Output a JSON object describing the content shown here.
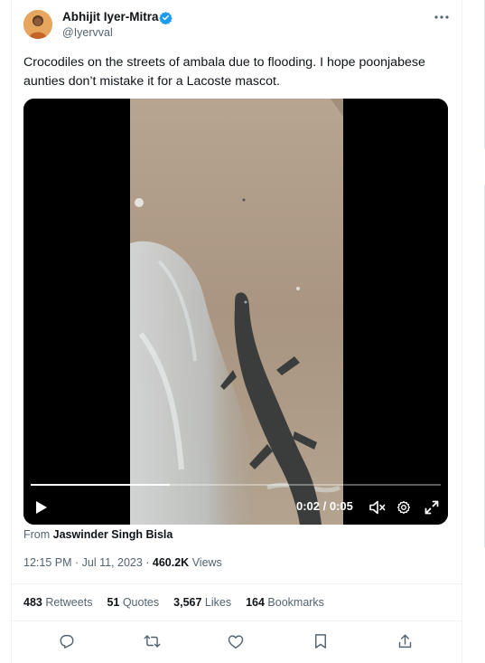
{
  "author": {
    "name": "Abhijit Iyer-Mitra",
    "handle": "@Iyervval"
  },
  "tweet": {
    "text": "Crocodiles on the streets of ambala due to flooding. I hope poonjabese aunties don’t mistake it for a Lacoste mascot."
  },
  "video": {
    "current_time": "0:02",
    "separator": " / ",
    "duration": "0:05",
    "progress": 0.34
  },
  "source": {
    "prefix": "From ",
    "name": "Jaswinder Singh Bisla"
  },
  "meta": {
    "timestamp": "12:15 PM · Jul 11, 2023",
    "dot": " · ",
    "views_count": "460.2K",
    "views_label": " Views"
  },
  "stats": {
    "retweets_count": "483",
    "retweets_label": " Retweets",
    "quotes_count": "51",
    "quotes_label": " Quotes",
    "likes_count": "3,567",
    "likes_label": " Likes",
    "bookmarks_count": "164",
    "bookmarks_label": " Bookmarks"
  },
  "colors": {
    "verified": "#1d9bf0",
    "secondary_text": "#536471",
    "primary_text": "#0f1419"
  },
  "icons": {
    "verified": "verified-badge-icon",
    "more": "more-dots-icon",
    "play": "play-icon",
    "mute": "volume-muted-icon",
    "settings": "gear-icon",
    "fullscreen": "expand-icon",
    "reply": "reply-icon",
    "retweet": "retweet-icon",
    "like": "heart-icon",
    "bookmark": "bookmark-icon",
    "share": "share-icon"
  }
}
